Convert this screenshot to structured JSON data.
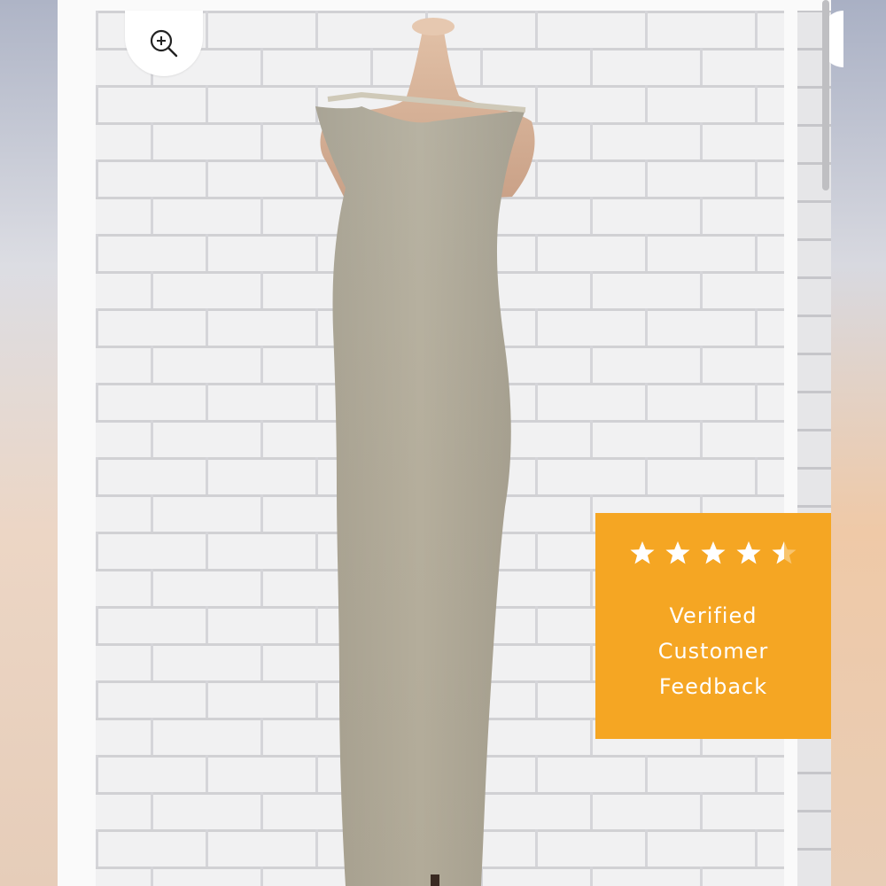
{
  "gallery": {
    "zoom_icon": "zoom-in-icon",
    "image_alt": "Beige knit one-shoulder maxi dress on mannequin"
  },
  "badge": {
    "rating": 4.5,
    "max_rating": 5,
    "line1": "Verified",
    "line2": "Customer",
    "line3": "Feedback",
    "color": "#f5a623"
  }
}
